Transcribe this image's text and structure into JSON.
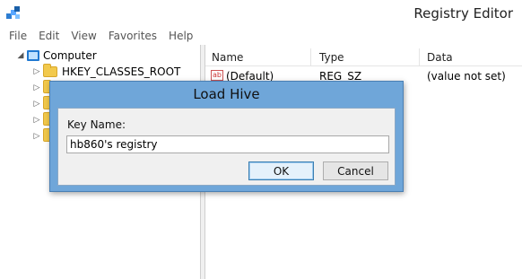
{
  "window": {
    "title": "Registry Editor",
    "icon": "registry-editor-icon"
  },
  "menu": [
    "File",
    "Edit",
    "View",
    "Favorites",
    "Help"
  ],
  "tree": {
    "root_label": "Computer",
    "items": [
      {
        "label": "HKEY_CLASSES_ROOT"
      }
    ]
  },
  "list": {
    "columns": [
      "Name",
      "Type",
      "Data"
    ],
    "rows": [
      {
        "name": "(Default)",
        "type": "REG_SZ",
        "data": "(value not set)"
      }
    ]
  },
  "dialog": {
    "title": "Load Hive",
    "key_label": "Key Name:",
    "key_value": "hb860's registry",
    "ok_label": "OK",
    "cancel_label": "Cancel"
  },
  "colors": {
    "dialog_frame": "#6fa6d9",
    "dialog_client": "#f0f0f0",
    "ok_button_border": "#3c7fb1"
  }
}
